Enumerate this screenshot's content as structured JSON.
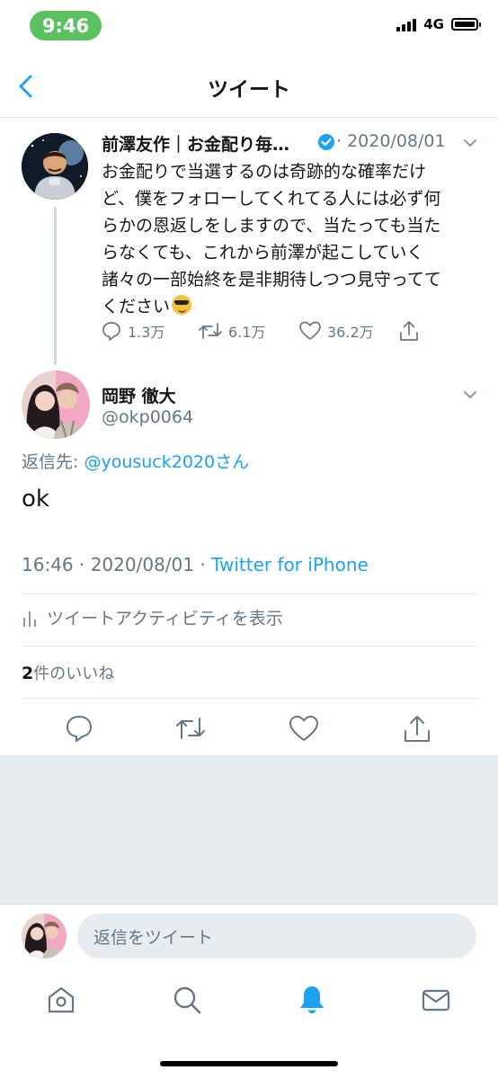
{
  "status": {
    "time": "9:46",
    "network": "4G"
  },
  "header": {
    "title": "ツイート"
  },
  "parent_tweet": {
    "name": "前澤友作｜お金配り毎…",
    "date": "· 2020/08/01",
    "lines": [
      "お金配りで当選するのは奇跡的な確率だけ",
      "ど、僕をフォローしてくれてる人には必ず何",
      "らかの恩返しをしますので、当たっても当た",
      "らなくても、これから前澤が起こしていく",
      "諸々の一部始終を是非期待しつつ見守ってて",
      "ください"
    ],
    "replies": "1.3万",
    "retweets": "6.1万",
    "likes": "36.2万"
  },
  "reply_tweet": {
    "name": "岡野 徹大",
    "handle": "@okp0064",
    "reply_to_prefix": "返信先: ",
    "reply_to_user": "@yousuck2020さん",
    "text": "ok",
    "timestamp": "16:46 · 2020/08/01 · ",
    "client": "Twitter for iPhone",
    "activity": "ツイートアクティビティを表示",
    "likes_count": "2",
    "likes_suffix": "件のいいね"
  },
  "compose": {
    "placeholder": "返信をツイート"
  },
  "icons": {
    "back": "chevron-left-icon",
    "verified": "verified-badge-icon",
    "reply": "reply-icon",
    "retweet": "retweet-icon",
    "like": "heart-icon",
    "share": "share-icon",
    "home": "home-icon",
    "search": "search-icon",
    "notifications": "bell-icon",
    "messages": "mail-icon"
  },
  "colors": {
    "accent": "#1da1f2",
    "text": "#14171a",
    "secondary": "#657786",
    "status_time_bg": "#5cc160"
  }
}
